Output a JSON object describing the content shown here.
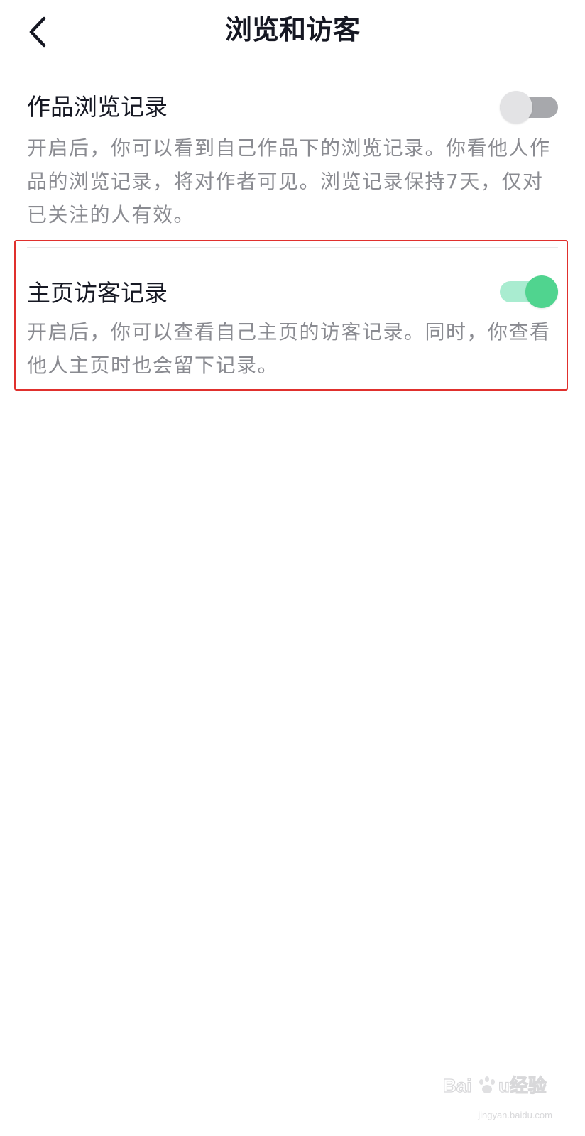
{
  "header": {
    "title": "浏览和访客",
    "back_icon": "chevron-left-icon"
  },
  "settings": [
    {
      "title": "作品浏览记录",
      "enabled": false,
      "description_lines": [
        "开启后，你可以看到自己作品下的浏览记录。你看他人作",
        "品的浏览记录，将对作者可见。浏览记录保持7天，仅对",
        "已关注的人有效。"
      ]
    },
    {
      "title": "主页访客记录",
      "enabled": true,
      "highlighted": true,
      "description_lines": [
        "开启后，你可以查看自己主页的访客记录。同时，你查看",
        "他人主页时也会留下记录。"
      ]
    }
  ],
  "colors": {
    "toggle_on": "#50d48f",
    "toggle_off": "#a7a8ac",
    "highlight": "#e0302d"
  },
  "watermark": {
    "logo_text": "Baidu经验",
    "url": "jingyan.baidu.com"
  }
}
